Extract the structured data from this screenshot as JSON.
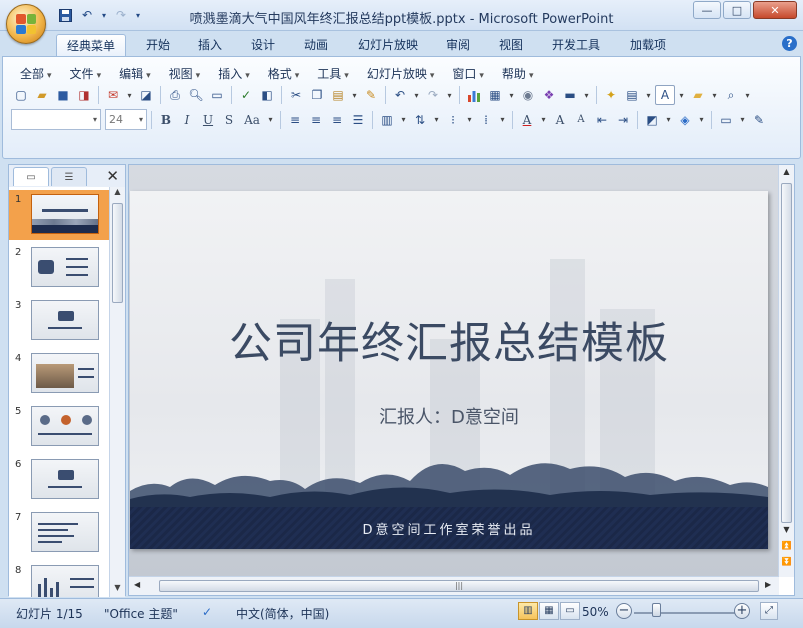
{
  "window": {
    "title": "喷溅墨滴大气中国风年终汇报总结ppt模板.pptx - Microsoft PowerPoint",
    "controls": {
      "minimize": "—",
      "maximize": "□",
      "close": "✕"
    }
  },
  "ribbon_tabs": [
    "经典菜单",
    "开始",
    "插入",
    "设计",
    "动画",
    "幻灯片放映",
    "审阅",
    "视图",
    "开发工具",
    "加载项"
  ],
  "menu": [
    "全部",
    "文件",
    "编辑",
    "视图",
    "插入",
    "格式",
    "工具",
    "幻灯片放映",
    "窗口",
    "帮助"
  ],
  "font": {
    "name": "",
    "size": "24"
  },
  "format_buttons": {
    "bold": "B",
    "italic": "I",
    "underline": "U",
    "shadow": "S",
    "case": "Aa",
    "font_color": "A",
    "grow": "A",
    "shrink": "A"
  },
  "pane": {
    "close_glyph": "✕"
  },
  "thumbnails": [
    "1",
    "2",
    "3",
    "4",
    "5",
    "6",
    "7",
    "8"
  ],
  "slide": {
    "title": "公司年终汇报总结模板",
    "subtitle": "汇报人：D意空间",
    "footer": "D意空间工作室荣誉出品"
  },
  "status": {
    "slide_info": "幻灯片 1/15",
    "theme": "\"Office 主题\"",
    "language": "中文(简体，中国)",
    "zoom": "50%"
  }
}
